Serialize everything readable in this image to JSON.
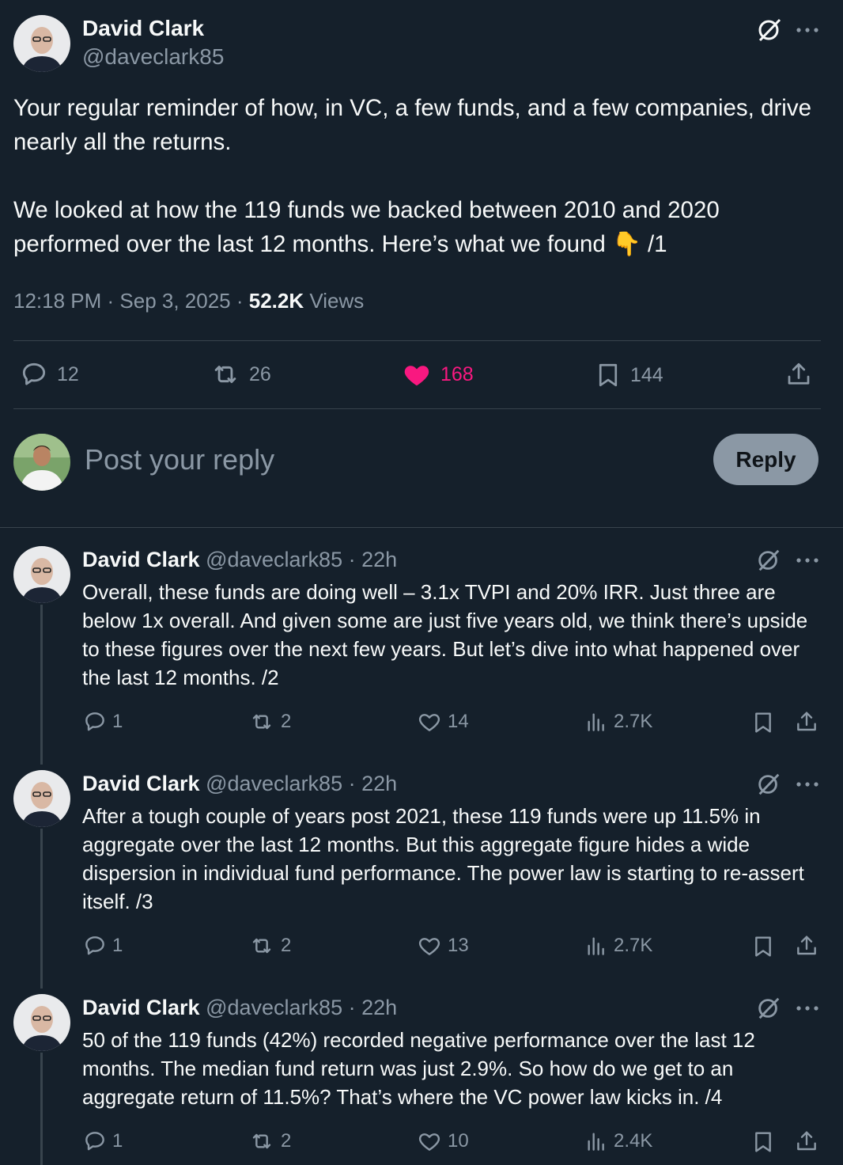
{
  "main_post": {
    "author_name": "David Clark",
    "author_handle": "@daveclark85",
    "text_p1": "Your regular reminder of how, in VC, a few funds, and a few companies, drive nearly all the returns.",
    "text_p2": "We looked at how the 119 funds we backed between 2010 and 2020 performed over the last 12 months. Here’s what we found",
    "text_emoji": "👇",
    "text_suffix": "/1",
    "time": "12:18 PM",
    "date": "Sep 3, 2025",
    "views_count": "52.2K",
    "views_label": "Views",
    "replies": "12",
    "reposts": "26",
    "likes": "168",
    "bookmarks": "144"
  },
  "composer": {
    "placeholder": "Post your reply",
    "button_label": "Reply"
  },
  "replies": [
    {
      "author_name": "David Clark",
      "author_handle": "@daveclark85",
      "time": "22h",
      "text": "Overall, these funds are doing well – 3.1x TVPI and 20% IRR. Just three are below 1x overall.  And given some are just five years old, we think there’s upside to these figures over the next few years. But let’s dive into what happened over the last 12 months. /2",
      "replies": "1",
      "reposts": "2",
      "likes": "14",
      "views": "2.7K"
    },
    {
      "author_name": "David Clark",
      "author_handle": "@daveclark85",
      "time": "22h",
      "text": "After a tough couple of years post 2021, these 119 funds were up 11.5% in aggregate over the last 12 months. But this aggregate figure hides a wide dispersion in individual fund performance. The power law is starting to re-assert itself. /3",
      "replies": "1",
      "reposts": "2",
      "likes": "13",
      "views": "2.7K"
    },
    {
      "author_name": "David Clark",
      "author_handle": "@daveclark85",
      "time": "22h",
      "text": "50 of the 119 funds (42%) recorded negative performance over the last 12 months. The median fund return was just 2.9%. So how do we get to an aggregate return of 11.5%? That’s where the VC power law kicks in. /4",
      "replies": "1",
      "reposts": "2",
      "likes": "10",
      "views": "2.4K"
    }
  ],
  "sep": " · ",
  "colors": {
    "background": "#15202b",
    "text": "#f7f9f9",
    "muted": "#8b98a5",
    "like_active": "#f91880",
    "divider": "#38444d",
    "reply_button_bg": "#8b98a5"
  }
}
